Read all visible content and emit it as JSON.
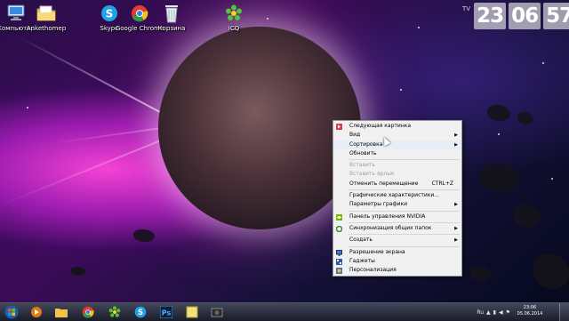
{
  "desktop_icons": [
    {
      "name": "computer",
      "label": "Компьютер",
      "icon": "computer-icon"
    },
    {
      "name": "folder",
      "label": "Ankethomep",
      "icon": "folder-icon"
    },
    {
      "name": "skype",
      "label": "Skype",
      "icon": "skype-icon"
    },
    {
      "name": "chrome",
      "label": "Google Chrome",
      "icon": "chrome-icon"
    },
    {
      "name": "recycle-bin",
      "label": "Корзина",
      "icon": "recycle-bin-icon"
    },
    {
      "name": "icq",
      "label": "ICQ",
      "icon": "icq-icon"
    }
  ],
  "clock_widget": {
    "prefix": "TV",
    "hours": "23",
    "minutes": "06",
    "seconds": "57"
  },
  "context_menu": {
    "items": [
      {
        "label": "Следующая картинка",
        "state": "enabled",
        "icon": "next-image-icon"
      },
      {
        "label": "Вид",
        "state": "enabled",
        "submenu": true
      },
      {
        "label": "Сортировка",
        "state": "enabled",
        "submenu": true
      },
      {
        "label": "Обновить",
        "state": "enabled"
      },
      {
        "label": "Вставить",
        "state": "disabled"
      },
      {
        "label": "Вставить ярлык",
        "state": "disabled"
      },
      {
        "label": "Отменить перемещение",
        "state": "enabled",
        "shortcut": "CTRL+Z"
      },
      {
        "label": "Графические характеристики...",
        "state": "enabled"
      },
      {
        "label": "Параметры графики",
        "state": "enabled",
        "submenu": true
      },
      {
        "label": "Панель управления NVIDIA",
        "state": "enabled",
        "icon": "nvidia-icon"
      },
      {
        "label": "Синхронизация общих папок",
        "state": "enabled",
        "submenu": true,
        "icon": "sync-icon"
      },
      {
        "label": "Создать",
        "state": "enabled",
        "submenu": true
      },
      {
        "label": "Разрешение экрана",
        "state": "enabled",
        "icon": "screen-resolution-icon"
      },
      {
        "label": "Гаджеты",
        "state": "enabled",
        "icon": "gadgets-icon"
      },
      {
        "label": "Персонализация",
        "state": "enabled",
        "icon": "personalization-icon"
      }
    ]
  },
  "taskbar": {
    "tray_lang": "Ru",
    "time": "23:06",
    "date": "05.06.2014"
  }
}
